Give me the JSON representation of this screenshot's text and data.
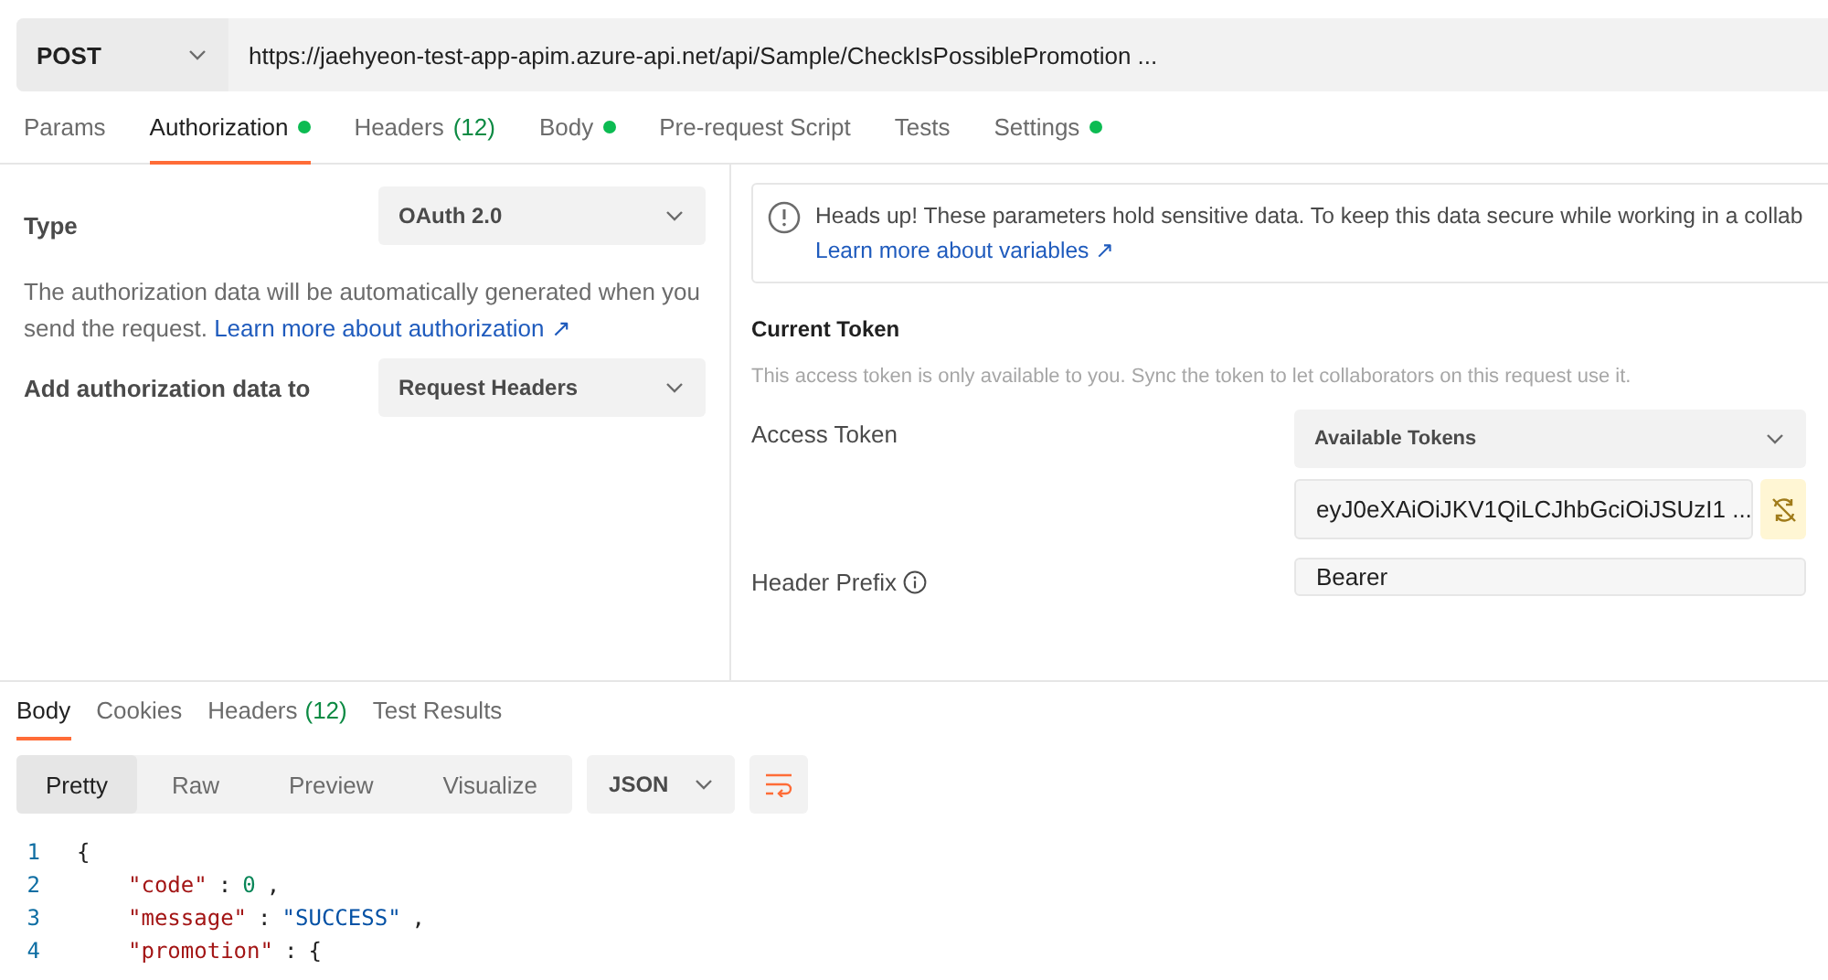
{
  "request": {
    "method": "POST",
    "url": "https://jaehyeon-test-app-apim.azure-api.net/api/Sample/CheckIsPossiblePromotion ..."
  },
  "request_tabs": [
    {
      "label": "Params",
      "dot": false,
      "selected": false
    },
    {
      "label": "Authorization",
      "dot": true,
      "selected": true
    },
    {
      "label": "Headers",
      "count": "(12)",
      "dot": false,
      "selected": false
    },
    {
      "label": "Body",
      "dot": true,
      "selected": false
    },
    {
      "label": "Pre-request Script",
      "dot": false,
      "selected": false
    },
    {
      "label": "Tests",
      "dot": false,
      "selected": false
    },
    {
      "label": "Settings",
      "dot": true,
      "selected": false
    }
  ],
  "auth": {
    "type_label": "Type",
    "type_value": "OAuth 2.0",
    "description": "The authorization data will be automatically generated when you send the request.",
    "description_link": "Learn more about authorization ↗",
    "add_to_label": "Add authorization data to",
    "add_to_value": "Request Headers"
  },
  "alert": {
    "text": "Heads up! These parameters hold sensitive data. To keep this data secure while working in a collab",
    "link": "Learn more about variables ↗"
  },
  "current_token": {
    "heading": "Current Token",
    "note": "This access token is only available to you. Sync the token to let collaborators on this request use it.",
    "access_token_label": "Access Token",
    "tokens_dropdown": "Available Tokens",
    "token_value": "eyJ0eXAiOiJKV1QiLCJhbGciOiJSUzI1 ...",
    "header_prefix_label": "Header Prefix",
    "header_prefix_value": "Bearer"
  },
  "response_tabs": [
    {
      "label": "Body",
      "selected": true
    },
    {
      "label": "Cookies",
      "selected": false
    },
    {
      "label": "Headers",
      "count": "(12)",
      "selected": false
    },
    {
      "label": "Test Results",
      "selected": false
    }
  ],
  "view_modes": [
    {
      "label": "Pretty",
      "selected": true
    },
    {
      "label": "Raw",
      "selected": false
    },
    {
      "label": "Preview",
      "selected": false
    },
    {
      "label": "Visualize",
      "selected": false
    }
  ],
  "format": "JSON",
  "code_lines": [
    {
      "number": "1",
      "tokens": [
        {
          "kind": "punct",
          "text": "{"
        }
      ]
    },
    {
      "number": "2",
      "tokens": [
        {
          "kind": "key",
          "text": "\"code\""
        },
        {
          "kind": "punct",
          "text": ":"
        },
        {
          "kind": "number",
          "text": "0"
        },
        {
          "kind": "punct",
          "text": ","
        }
      ]
    },
    {
      "number": "3",
      "tokens": [
        {
          "kind": "key",
          "text": "\"message\""
        },
        {
          "kind": "punct",
          "text": ":"
        },
        {
          "kind": "string",
          "text": "\"SUCCESS\""
        },
        {
          "kind": "punct",
          "text": ","
        }
      ]
    },
    {
      "number": "4",
      "tokens": [
        {
          "kind": "key",
          "text": "\"promotion\""
        },
        {
          "kind": "punct",
          "text": ":"
        },
        {
          "kind": "punct",
          "text": "{"
        }
      ]
    }
  ]
}
